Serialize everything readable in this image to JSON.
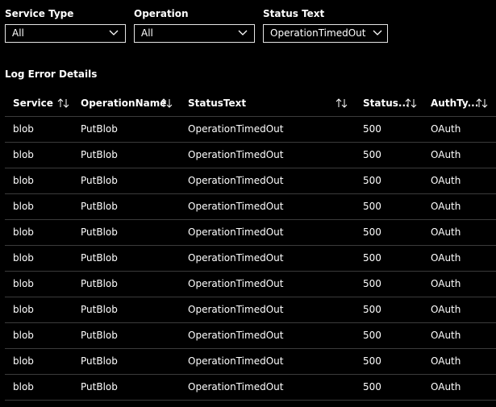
{
  "filters": {
    "service_type": {
      "label": "Service Type",
      "value": "All"
    },
    "operation": {
      "label": "Operation",
      "value": "All"
    },
    "status_text": {
      "label": "Status Text",
      "value": "OperationTimedOut"
    }
  },
  "section_title": "Log Error Details",
  "table": {
    "columns": [
      "Service",
      "OperationName",
      "StatusText",
      "Status...",
      "AuthTy..."
    ],
    "rows": [
      [
        "blob",
        "PutBlob",
        "OperationTimedOut",
        "500",
        "OAuth"
      ],
      [
        "blob",
        "PutBlob",
        "OperationTimedOut",
        "500",
        "OAuth"
      ],
      [
        "blob",
        "PutBlob",
        "OperationTimedOut",
        "500",
        "OAuth"
      ],
      [
        "blob",
        "PutBlob",
        "OperationTimedOut",
        "500",
        "OAuth"
      ],
      [
        "blob",
        "PutBlob",
        "OperationTimedOut",
        "500",
        "OAuth"
      ],
      [
        "blob",
        "PutBlob",
        "OperationTimedOut",
        "500",
        "OAuth"
      ],
      [
        "blob",
        "PutBlob",
        "OperationTimedOut",
        "500",
        "OAuth"
      ],
      [
        "blob",
        "PutBlob",
        "OperationTimedOut",
        "500",
        "OAuth"
      ],
      [
        "blob",
        "PutBlob",
        "OperationTimedOut",
        "500",
        "OAuth"
      ],
      [
        "blob",
        "PutBlob",
        "OperationTimedOut",
        "500",
        "OAuth"
      ],
      [
        "blob",
        "PutBlob",
        "OperationTimedOut",
        "500",
        "OAuth"
      ]
    ]
  },
  "icons": {
    "dropdown": "chevron-down-icon",
    "sort": "sort-icon"
  }
}
